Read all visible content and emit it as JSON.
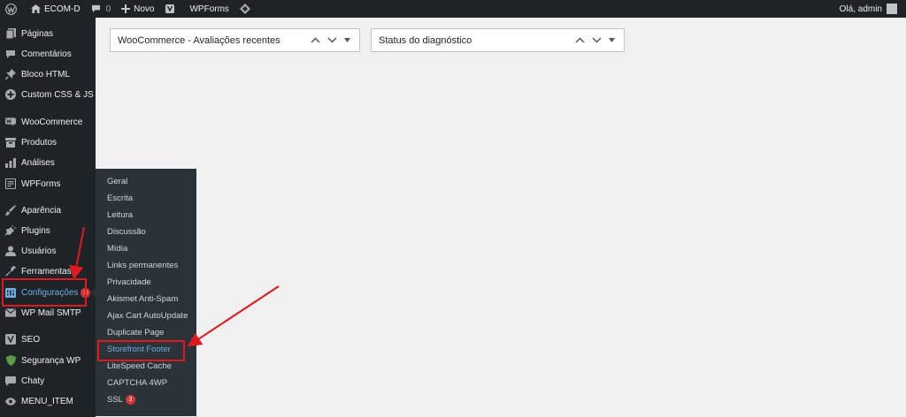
{
  "adminbar": {
    "site_name": "ECOM-D",
    "comments_count": "0",
    "new_label": "Novo",
    "wpforms_label": "WPForms",
    "greeting": "Olá, admin"
  },
  "sidebar": {
    "items": [
      {
        "label": "Páginas",
        "icon": "pages-icon"
      },
      {
        "label": "Comentários",
        "icon": "comments-icon"
      },
      {
        "label": "Bloco HTML",
        "icon": "pin-icon"
      },
      {
        "label": "Custom CSS & JS",
        "icon": "plus-circle-icon"
      },
      {
        "label": "WooCommerce",
        "icon": "woocommerce-icon"
      },
      {
        "label": "Produtos",
        "icon": "products-icon"
      },
      {
        "label": "Análises",
        "icon": "analytics-icon"
      },
      {
        "label": "WPForms",
        "icon": "wpforms-icon"
      },
      {
        "label": "Aparência",
        "icon": "brush-icon"
      },
      {
        "label": "Plugins",
        "icon": "plug-icon"
      },
      {
        "label": "Usuários",
        "icon": "user-icon"
      },
      {
        "label": "Ferramentas",
        "icon": "wrench-icon"
      },
      {
        "label": "Configurações",
        "icon": "settings-icon",
        "badge": "3"
      },
      {
        "label": "WP Mail SMTP",
        "icon": "mail-icon"
      },
      {
        "label": "SEO",
        "icon": "yoast-icon"
      },
      {
        "label": "Segurança WP",
        "icon": "shield-icon"
      },
      {
        "label": "Chaty",
        "icon": "chat-icon"
      },
      {
        "label": "MENU_ITEM",
        "icon": "eye-icon"
      }
    ]
  },
  "submenu": {
    "items": [
      {
        "label": "Geral"
      },
      {
        "label": "Escrita"
      },
      {
        "label": "Leitura"
      },
      {
        "label": "Discussão"
      },
      {
        "label": "Mídia"
      },
      {
        "label": "Links permanentes"
      },
      {
        "label": "Privacidade"
      },
      {
        "label": "Akismet Anti-Spam"
      },
      {
        "label": "Ajax Cart AutoUpdate"
      },
      {
        "label": "Duplicate Page"
      },
      {
        "label": "Storefront Footer"
      },
      {
        "label": "LiteSpeed Cache"
      },
      {
        "label": "CAPTCHA 4WP"
      },
      {
        "label": "SSL",
        "badge": "3"
      }
    ]
  },
  "widgets": [
    {
      "title": "WooCommerce - Avaliações recentes"
    },
    {
      "title": "Status do diagnóstico"
    }
  ],
  "colors": {
    "admin_bar": "#1d2327",
    "sidebar": "#1d2327",
    "submenu": "#2c3338",
    "current_link": "#72aee6",
    "badge": "#d63638",
    "annotation": "#e0191f"
  }
}
